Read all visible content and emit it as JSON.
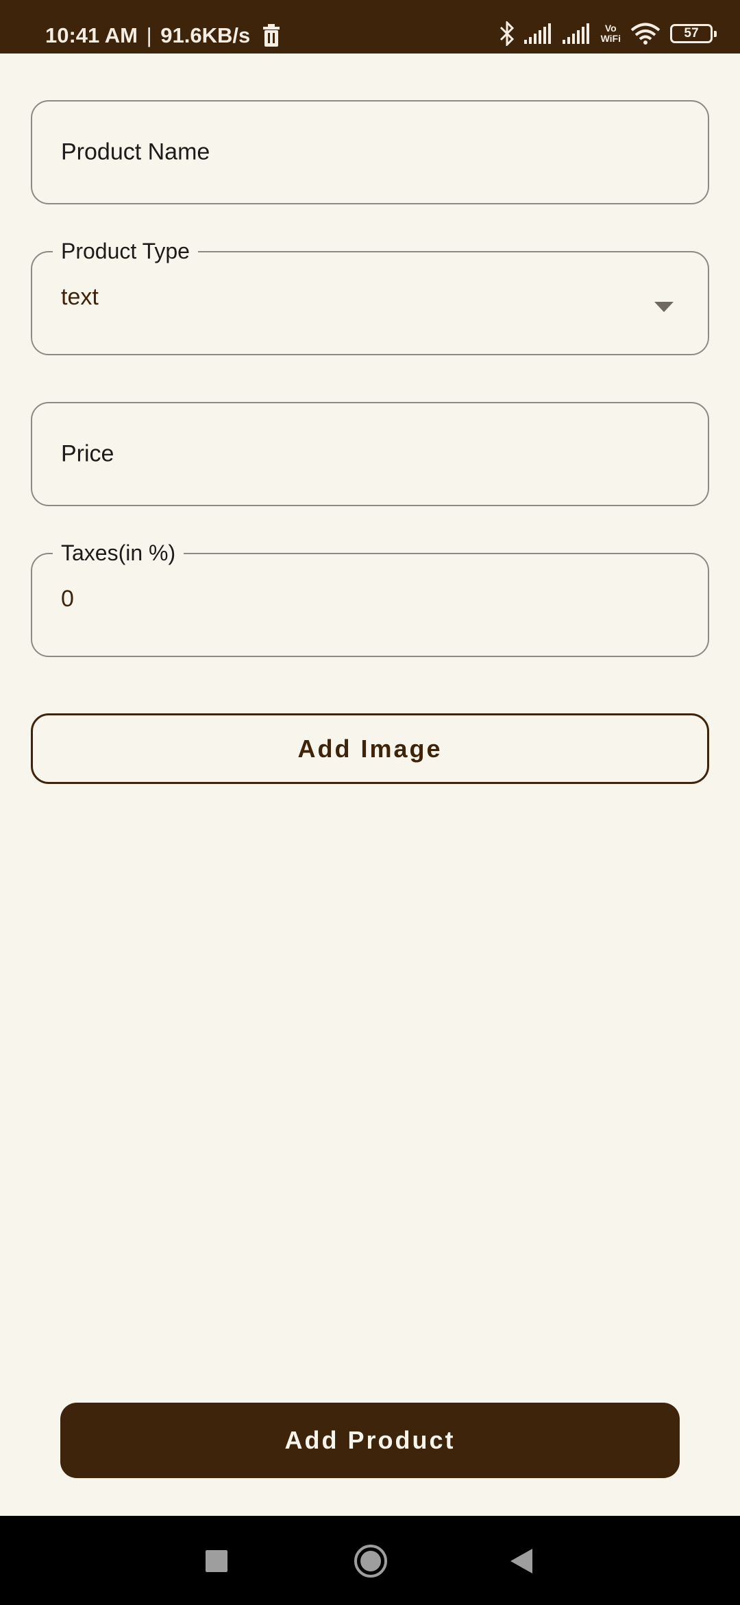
{
  "status_bar": {
    "time": "10:41 AM",
    "separator": "|",
    "net_speed": "91.6KB/s",
    "vowifi_line1": "Vo",
    "vowifi_line2": "WiFi",
    "battery_level": "57",
    "icons": [
      "trash-icon",
      "bluetooth-icon",
      "signal-icon",
      "signal-icon",
      "vowifi-icon",
      "wifi-icon",
      "battery-icon"
    ]
  },
  "form": {
    "product_name": {
      "placeholder": "Product Name"
    },
    "product_type": {
      "label": "Product Type",
      "value": "text",
      "icon": "dropdown-arrow-icon"
    },
    "price": {
      "placeholder": "Price"
    },
    "taxes": {
      "label": "Taxes(in %)",
      "value": "0"
    }
  },
  "buttons": {
    "add_image": "Add Image",
    "add_product": "Add Product"
  },
  "nav_bar": {
    "icons": [
      "recents-square-icon",
      "home-circle-icon",
      "back-triangle-icon"
    ]
  },
  "colors": {
    "brand_brown": "#3E240A",
    "background": "#F8F5EC",
    "field_border": "#8B8A85"
  }
}
